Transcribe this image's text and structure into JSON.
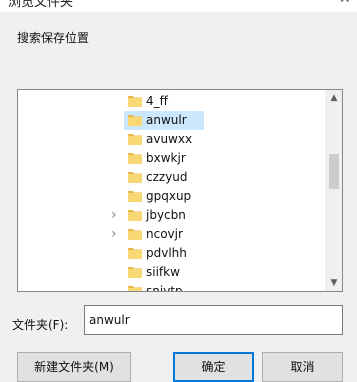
{
  "window": {
    "title": "浏览文件夹",
    "close_glyph": "✕"
  },
  "instruction": "搜索保存位置",
  "tree": {
    "items": [
      {
        "label": "4_ff",
        "expandable": false,
        "selected": false
      },
      {
        "label": "anwulr",
        "expandable": false,
        "selected": true
      },
      {
        "label": "avuwxx",
        "expandable": false,
        "selected": false
      },
      {
        "label": "bxwkjr",
        "expandable": false,
        "selected": false
      },
      {
        "label": "czzyud",
        "expandable": false,
        "selected": false
      },
      {
        "label": "gpqxup",
        "expandable": false,
        "selected": false
      },
      {
        "label": "jbycbn",
        "expandable": true,
        "selected": false
      },
      {
        "label": "ncovjr",
        "expandable": true,
        "selected": false
      },
      {
        "label": "pdvlhh",
        "expandable": false,
        "selected": false
      },
      {
        "label": "siifkw",
        "expandable": false,
        "selected": false
      },
      {
        "label": "snjvtp",
        "expandable": false,
        "selected": false
      }
    ],
    "folder_color": "#f8d775",
    "folder_tab_color": "#e8b94a",
    "selection_color": "#cce8ff",
    "scroll_up_glyph": "▲",
    "scroll_down_glyph": "▼"
  },
  "folder_field": {
    "label": "文件夹(F):",
    "value": "anwulr"
  },
  "buttons": {
    "new_folder": "新建文件夹(M)",
    "ok": "确定",
    "cancel": "取消"
  },
  "accent_color": "#0078d7"
}
